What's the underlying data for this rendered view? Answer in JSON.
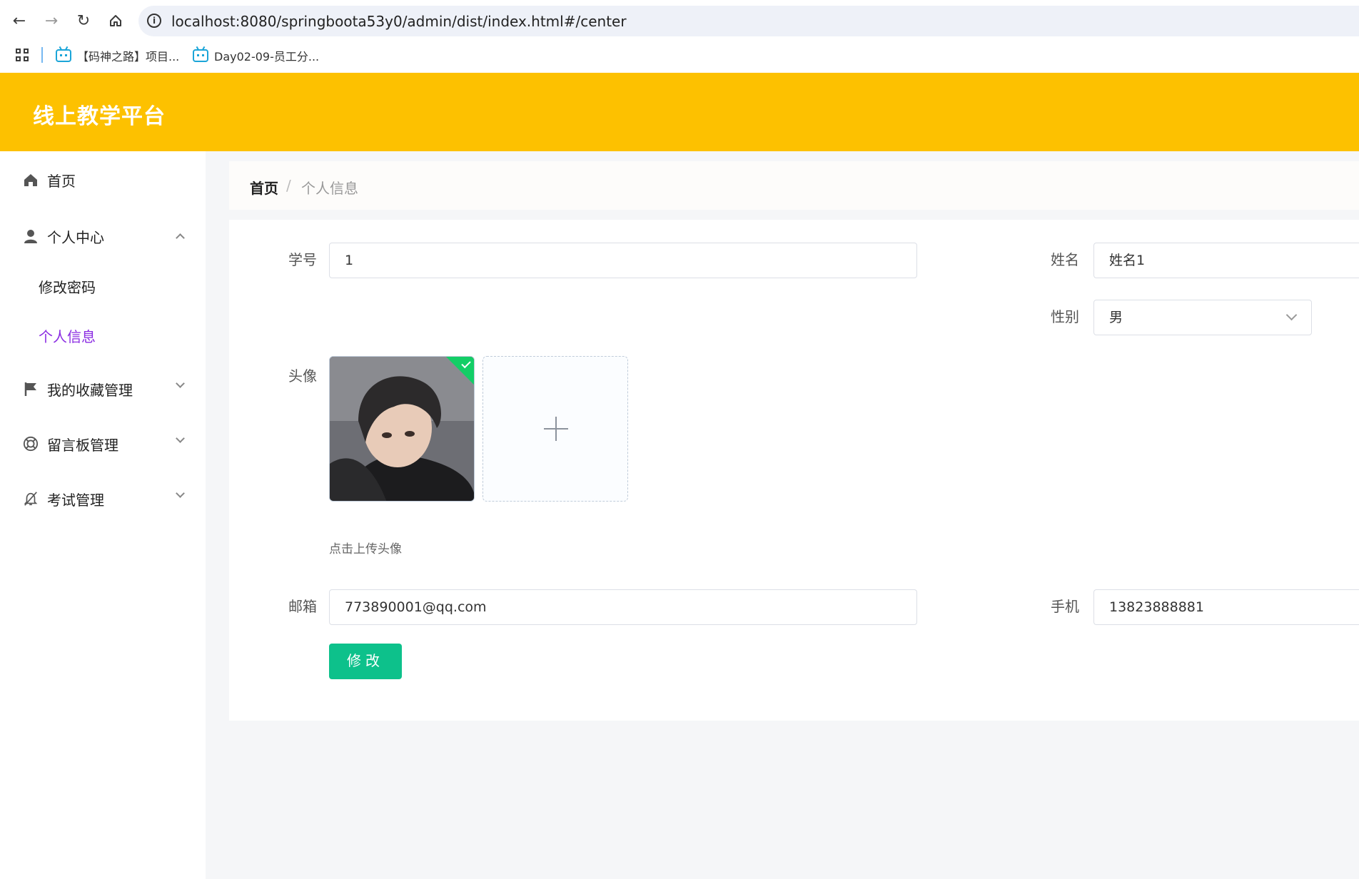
{
  "browser": {
    "url": "localhost:8080/springboota53y0/admin/dist/index.html#/center",
    "bookmarks": [
      {
        "label": "【码神之路】项目..."
      },
      {
        "label": "Day02-09-员工分..."
      }
    ]
  },
  "header": {
    "title": "线上教学平台",
    "accent_color": "#fdc100"
  },
  "sidebar": {
    "items": [
      {
        "label": "首页",
        "icon": "home-icon"
      },
      {
        "label": "个人中心",
        "icon": "user-icon",
        "expanded": true,
        "children": [
          {
            "label": "修改密码"
          },
          {
            "label": "个人信息",
            "active": true
          }
        ]
      },
      {
        "label": "我的收藏管理",
        "icon": "flag-icon"
      },
      {
        "label": "留言板管理",
        "icon": "lifebuoy-icon"
      },
      {
        "label": "考试管理",
        "icon": "bell-off-icon"
      }
    ],
    "active_color": "#8a2be2"
  },
  "breadcrumb": {
    "home": "首页",
    "separator": "/",
    "current": "个人信息"
  },
  "form": {
    "student_id": {
      "label": "学号",
      "value": "1"
    },
    "name": {
      "label": "姓名",
      "value": "姓名1"
    },
    "gender": {
      "label": "性别",
      "value": "男"
    },
    "avatar": {
      "label": "头像",
      "tip": "点击上传头像"
    },
    "email": {
      "label": "邮箱",
      "value": "773890001@qq.com"
    },
    "phone": {
      "label": "手机",
      "value": "13823888881"
    },
    "submit_label": "修改",
    "submit_color": "#0dc18b"
  }
}
